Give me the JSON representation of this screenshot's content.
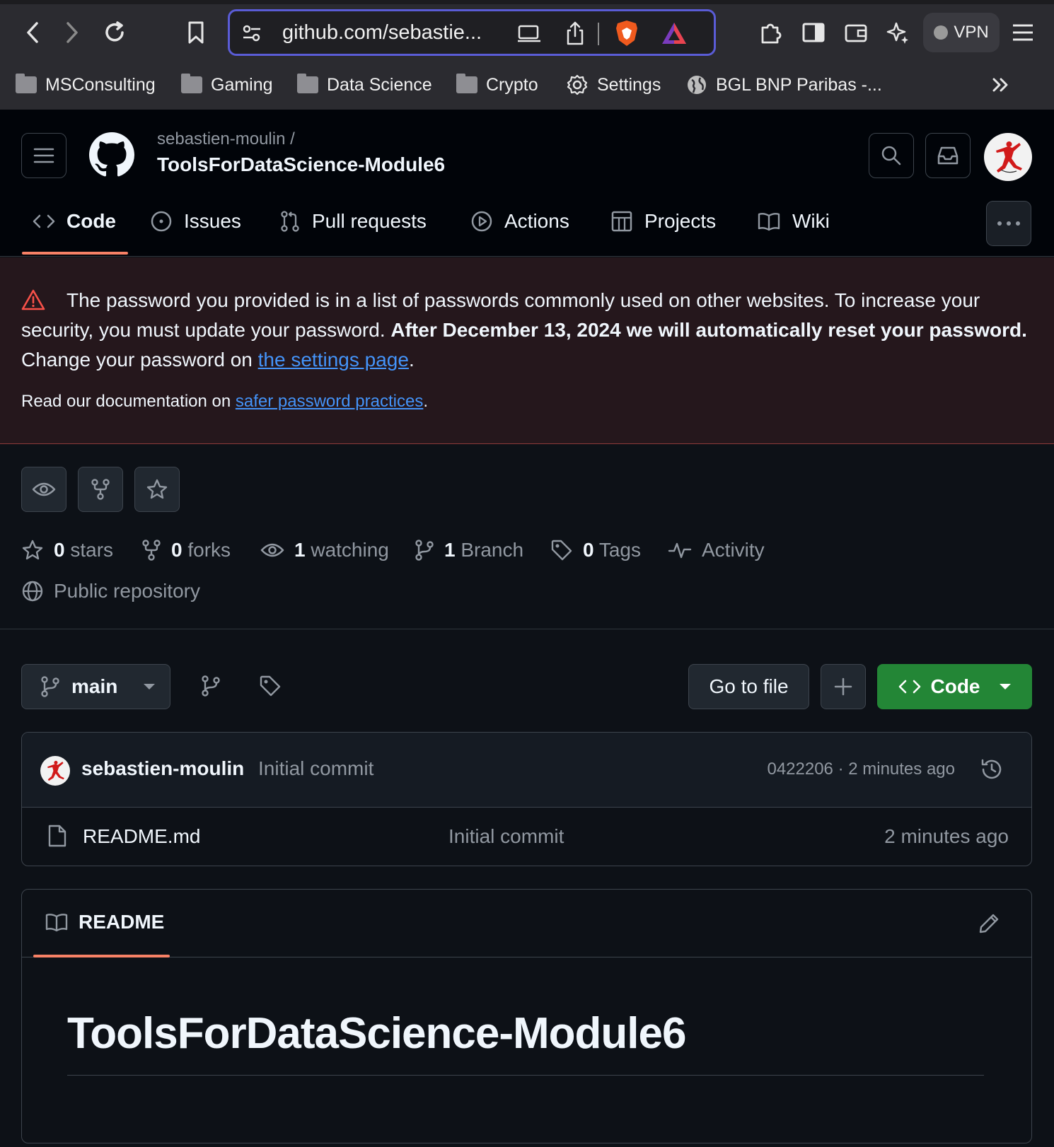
{
  "browser": {
    "url": "github.com/sebastie...",
    "vpn_label": "VPN",
    "bookmarks": [
      "MSConsulting",
      "Gaming",
      "Data Science",
      "Crypto",
      "Settings",
      "BGL BNP Paribas -..."
    ]
  },
  "header": {
    "owner": "sebastien-moulin /",
    "repo": "ToolsForDataScience-Module6"
  },
  "tabs": [
    {
      "label": "Code",
      "icon": "code-icon"
    },
    {
      "label": "Issues",
      "icon": "issue-icon"
    },
    {
      "label": "Pull requests",
      "icon": "pull-request-icon"
    },
    {
      "label": "Actions",
      "icon": "play-icon"
    },
    {
      "label": "Projects",
      "icon": "table-icon"
    },
    {
      "label": "Wiki",
      "icon": "book-icon"
    }
  ],
  "warning": {
    "text_1": "The password you provided is in a list of passwords commonly used on other websites. To increase your security, you must update your password. ",
    "text_bold": "After December 13, 2024 we will automatically reset your password.",
    "text_2": " Change your password on ",
    "link": "the settings page",
    "text_end": ".",
    "doc_prefix": "Read our documentation on ",
    "doc_link": "safer password practices",
    "doc_end": "."
  },
  "stats": {
    "stars_count": "0",
    "stars_label": "stars",
    "forks_count": "0",
    "forks_label": "forks",
    "watching_count": "1",
    "watching_label": "watching",
    "branch_count": "1",
    "branch_label": "Branch",
    "tags_count": "0",
    "tags_label": "Tags",
    "activity_label": "Activity",
    "visibility": "Public repository"
  },
  "toolbar": {
    "branch": "main",
    "go_to_file": "Go to file",
    "code_label": "Code"
  },
  "commit": {
    "author": "sebastien-moulin",
    "message": "Initial commit",
    "meta": "0422206 · 2 minutes ago"
  },
  "files": [
    {
      "name": "README.md",
      "message": "Initial commit",
      "time": "2 minutes ago"
    }
  ],
  "readme": {
    "tab_label": "README",
    "title": "ToolsForDataScience-Module6"
  },
  "colors": {
    "accent_green": "#238636",
    "tab_underline": "#f78166",
    "link_blue": "#4493f8",
    "warning_red": "#f85149"
  }
}
